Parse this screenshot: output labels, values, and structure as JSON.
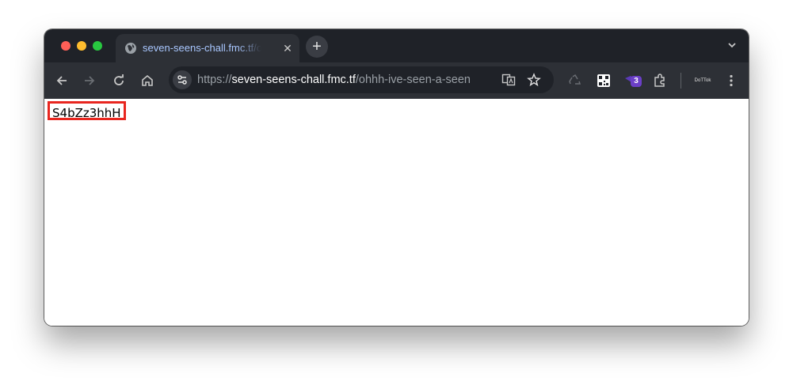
{
  "browser": {
    "tab": {
      "title": "seven-seens-chall.fmc.tf/ohhh-ive-seen-a-seen"
    },
    "address_bar": {
      "scheme": "https://",
      "host": "seven-seens-chall.fmc.tf",
      "path": "/ohhh-ive-seen-a-seen"
    },
    "extensions": {
      "badge_count": "3"
    },
    "profile": {
      "label": "DoTTok"
    }
  },
  "page": {
    "text": "S4bZz3hhH"
  },
  "colors": {
    "highlight_border": "#e8261f",
    "tab_title": "#a9c7ff",
    "toolbar_bg": "#2d3036",
    "titlebar_bg": "#1f2228"
  }
}
